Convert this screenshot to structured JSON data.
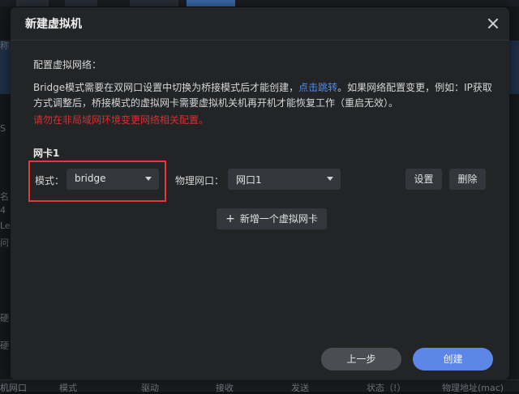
{
  "background": {
    "left_texts": [
      "称",
      "S",
      "名",
      "4",
      "Le",
      "问",
      "硬",
      "硬"
    ],
    "bottom_columns": [
      "机网口",
      "模式",
      "驱动",
      "接收",
      "发送",
      "状态（!）",
      "物理地址(mac)"
    ]
  },
  "dialog": {
    "title": "新建虚拟机",
    "section_title": "配置虚拟网络：",
    "description_part1": "Bridge模式需要在双网口设置中切换为桥接模式后才能创建，",
    "description_link": "点击跳转",
    "description_part2": "。如果网络配置变更，例如：IP获取方式调整后，桥接模式的虚拟网卡需要虚拟机关机再开机才能恢复工作（重启无效）。",
    "warning": "请勿在非局域网环境变更网络相关配置。",
    "nic": {
      "title": "网卡1",
      "mode_label": "模式：",
      "mode_value": "bridge",
      "port_label": "物理网口：",
      "port_value": "网口1",
      "settings_button": "设置",
      "delete_button": "删除"
    },
    "add_nic_button": "新增一个虚拟网卡",
    "prev_button": "上一步",
    "create_button": "创建"
  },
  "colors": {
    "link": "#4f8cf0",
    "warning": "#d63030",
    "primary_button": "#5c86e8",
    "highlight_border": "#e23a3a"
  }
}
